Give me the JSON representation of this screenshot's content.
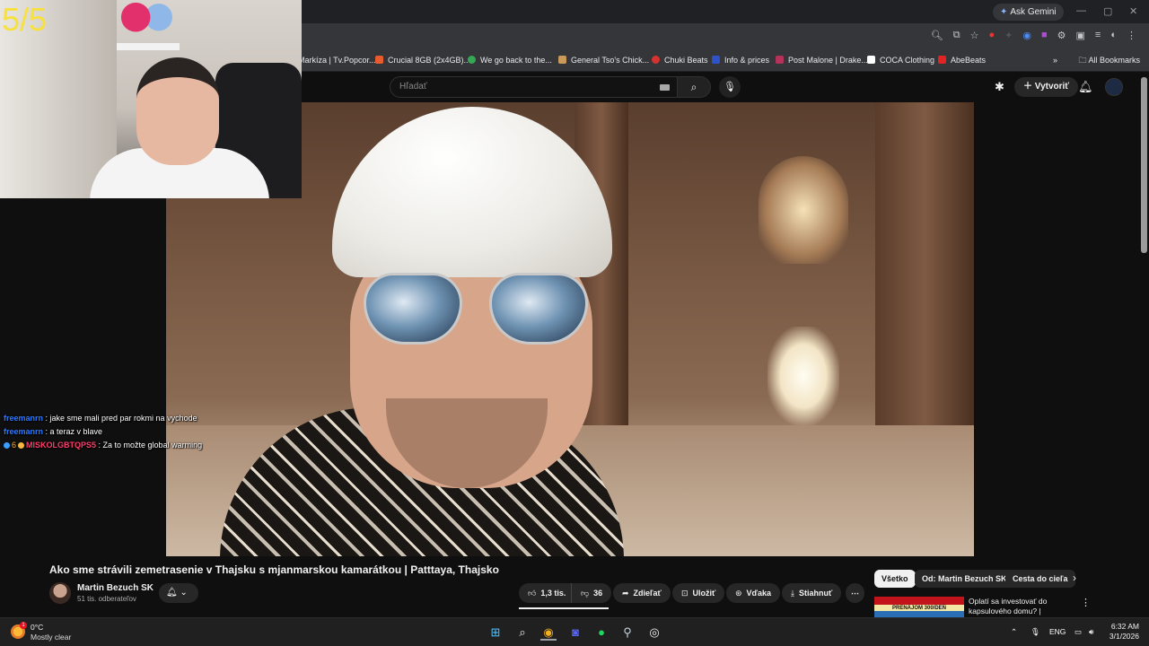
{
  "browser": {
    "gemini_label": "Ask Gemini",
    "window_controls": [
      "—",
      "▢",
      "✕"
    ],
    "bookmarks": [
      {
        "label": "Markíza | Tv.Popcor...",
        "color": "#3a76f0"
      },
      {
        "label": "Crucial 8GB (2x4GB)...",
        "color": "#e65c2e"
      },
      {
        "label": "We go back to the...",
        "color": "#34a853"
      },
      {
        "label": "General Tso's Chick...",
        "color": "#c99a5b"
      },
      {
        "label": "Chuki Beats",
        "color": "#d6332e"
      },
      {
        "label": "Info & prices",
        "color": "#2f52c9"
      },
      {
        "label": "Post Malone | Drake...",
        "color": "#b5335a"
      },
      {
        "label": "COCA Clothing",
        "color": "#ffffff"
      },
      {
        "label": "AbeBeats",
        "color": "#e02424"
      }
    ],
    "all_bookmarks_label": "All Bookmarks"
  },
  "youtube": {
    "search_placeholder": "Hľadať",
    "create_label": "Vytvoriť",
    "video_title": "Ako sme strávili zemetrasenie v Thajsku s mjanmarskou kamarátkou | Patttaya, Thajsko",
    "channel_name": "Martin Bezuch SK",
    "subscribers": "51 tis. odberateľov",
    "likes": "1,3 tis.",
    "dislikes": "36",
    "share_label": "Zdieľať",
    "save_label": "Uložiť",
    "thanks_label": "Vďaka",
    "download_label": "Stiahnuť",
    "more_label": "⋯",
    "chips": [
      "Všetko",
      "Od: Martin Bezuch SK",
      "Cesta do cieľa"
    ],
    "rec_title": "Oplatí sa investovať do kapsulového domu? | Pattaya, ...",
    "rec_thumb_text": "PRENÁJOM 300/DEŇ"
  },
  "stream": {
    "counter": "5/5",
    "chat": [
      {
        "user": "freemanrn",
        "message": " : jake sme mali pred par rokmi na vychode"
      },
      {
        "user": "freemanrn",
        "message": " : a teraz v blave"
      },
      {
        "user": "MISKOLGBTQPS5",
        "message": " : Za to možte global warming",
        "badge_count": "6"
      }
    ]
  },
  "taskbar": {
    "temperature": "0°C",
    "weather": "Mostly clear",
    "weather_badge": "1",
    "language": "ENG",
    "time": "6:32 AM",
    "date": "3/1/2026"
  }
}
